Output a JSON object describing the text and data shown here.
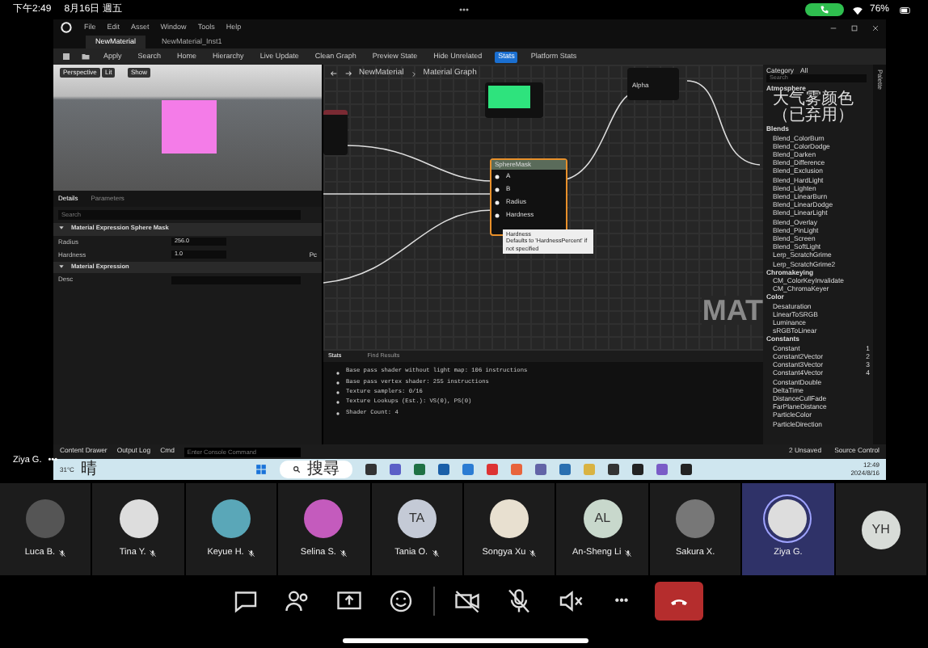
{
  "status_bar": {
    "time": "下午2:49",
    "date": "8月16日 週五",
    "battery": "76%"
  },
  "editor": {
    "menu": [
      "File",
      "Edit",
      "Asset",
      "Window",
      "Tools",
      "Help"
    ],
    "tabs": [
      {
        "label": "NewMaterial",
        "selected": true
      },
      {
        "label": "NewMaterial_Inst1",
        "selected": false
      }
    ],
    "toolbar": [
      {
        "label": "Apply",
        "selected": false
      },
      {
        "label": "Search",
        "selected": false
      },
      {
        "label": "Home",
        "selected": false
      },
      {
        "label": "Hierarchy",
        "selected": false
      },
      {
        "label": "Live Update",
        "selected": false
      },
      {
        "label": "Clean Graph",
        "selected": false
      },
      {
        "label": "Preview State",
        "selected": false
      },
      {
        "label": "Hide Unrelated",
        "selected": false
      },
      {
        "label": "Stats",
        "selected": true
      },
      {
        "label": "Platform Stats",
        "selected": false
      }
    ],
    "viewport": {
      "buttons": [
        "Perspective",
        "Lit",
        "Show"
      ]
    },
    "details": {
      "tabs": [
        {
          "label": "Details",
          "selected": true
        },
        {
          "label": "Parameters",
          "selected": false
        }
      ],
      "search": {
        "placeholder": "Search"
      },
      "sections": [
        {
          "title": "Material Expression Sphere Mask",
          "expanded": true,
          "rows": [
            {
              "label": "Radius",
              "value": "256.0"
            },
            {
              "label": "Hardness",
              "value": "1.0",
              "unit": "Pc"
            }
          ]
        },
        {
          "title": "Material Expression",
          "expanded": true,
          "rows": [
            {
              "label": "Desc"
            }
          ]
        }
      ]
    },
    "graph": {
      "breadcrumb": [
        "NewMaterial",
        "Material Graph"
      ],
      "node": {
        "title": "SphereMask",
        "pins": [
          "A",
          "B",
          "Radius",
          "Hardness"
        ]
      },
      "alpha_pin": "Alpha",
      "tooltip": {
        "title": "Hardness",
        "text": "Defaults to 'HardnessPercent' if not specified"
      },
      "watermark": "MAT"
    },
    "stats": {
      "tabs": [
        {
          "label": "Stats",
          "selected": true
        },
        {
          "label": "Find Results",
          "selected": false
        }
      ],
      "lines": [
        "Base pass shader without light map: 106 instructions",
        "Base pass vertex shader: 255 instructions",
        "Texture samplers: 0/16",
        "Texture Lookups (Est.): VS(0), PS(0)",
        "Shader Count: 4"
      ]
    },
    "palette": {
      "category_label": "Category",
      "category": "All",
      "search": {
        "placeholder": "Search"
      },
      "side_tab": "Palette",
      "groups": [
        {
          "name": "Atmosphere",
          "items": [
            {
              "label": "大气雾颜色（已弃用）"
            }
          ]
        },
        {
          "name": "Blends",
          "items": [
            {
              "label": "Blend_ColorBurn"
            },
            {
              "label": "Blend_ColorDodge"
            },
            {
              "label": "Blend_Darken"
            },
            {
              "label": "Blend_Difference"
            },
            {
              "label": "Blend_Exclusion"
            },
            {
              "label": "Blend_HardLight"
            },
            {
              "label": "Blend_Lighten"
            },
            {
              "label": "Blend_LinearBurn"
            },
            {
              "label": "Blend_LinearDodge"
            },
            {
              "label": "Blend_LinearLight"
            },
            {
              "label": "Blend_Overlay"
            },
            {
              "label": "Blend_PinLight"
            },
            {
              "label": "Blend_Screen"
            },
            {
              "label": "Blend_SoftLight"
            },
            {
              "label": "Lerp_ScratchGrime"
            },
            {
              "label": "Lerp_ScratchGrime2"
            }
          ]
        },
        {
          "name": "Chromakeying",
          "items": [
            {
              "label": "CM_ColorKeyInvalidate"
            },
            {
              "label": "CM_ChromaKeyer"
            }
          ]
        },
        {
          "name": "Color",
          "items": [
            {
              "label": "Desaturation"
            },
            {
              "label": "LinearToSRGB"
            },
            {
              "label": "Luminance"
            },
            {
              "label": "sRGBToLinear"
            }
          ]
        },
        {
          "name": "Constants",
          "items": [
            {
              "label": "Constant",
              "shortcut": "1"
            },
            {
              "label": "Constant2Vector",
              "shortcut": "2"
            },
            {
              "label": "Constant3Vector",
              "shortcut": "3"
            },
            {
              "label": "Constant4Vector",
              "shortcut": "4"
            },
            {
              "label": "ConstantDouble"
            },
            {
              "label": "DeltaTime"
            },
            {
              "label": "DistanceCullFade"
            },
            {
              "label": "FarPlaneDistance"
            },
            {
              "label": "ParticleColor"
            },
            {
              "label": "ParticleDirection"
            }
          ]
        }
      ]
    },
    "bottom_bar": {
      "items": [
        "Content Drawer",
        "Output Log",
        "Cmd"
      ],
      "console": {
        "placeholder": "Enter Console Command"
      },
      "right": [
        "2 Unsaved",
        "Source Control"
      ]
    }
  },
  "taskbar": {
    "weather": "31°C",
    "weather_text": "晴",
    "search": "搜尋",
    "time": "12:49",
    "date": "2024/8/16"
  },
  "presenter": {
    "name": "Ziya G.",
    "menu": "•••"
  },
  "participants": [
    {
      "name": "Luca B.",
      "kind": "photo",
      "muted": true,
      "selected": false
    },
    {
      "name": "Tina Y.",
      "kind": "photo",
      "muted": true,
      "selected": false
    },
    {
      "name": "Keyue H.",
      "kind": "photo",
      "muted": true,
      "selected": false
    },
    {
      "name": "Selina S.",
      "kind": "photo",
      "muted": true,
      "selected": false
    },
    {
      "name": "Tania O.",
      "kind": "initials",
      "initials": "TA",
      "muted": true,
      "selected": false
    },
    {
      "name": "Songya Xu",
      "kind": "photo",
      "muted": true,
      "selected": false
    },
    {
      "name": "An-Sheng Li",
      "kind": "initials",
      "initials": "AL",
      "muted": true,
      "selected": false
    },
    {
      "name": "Sakura X.",
      "kind": "photo",
      "muted": false,
      "selected": false
    },
    {
      "name": "Ziya G.",
      "kind": "photo",
      "muted": false,
      "selected": true
    },
    {
      "kind": "initials",
      "initials": "YH",
      "muted": false,
      "selected": false
    }
  ],
  "controls": [
    {
      "kind": "chat"
    },
    {
      "kind": "people"
    },
    {
      "kind": "share"
    },
    {
      "kind": "react"
    },
    {
      "kind": "camera",
      "on": false
    },
    {
      "kind": "mic",
      "on": false
    },
    {
      "kind": "speaker",
      "on": false
    },
    {
      "kind": "more",
      "label": "•••"
    },
    {
      "kind": "hangup"
    }
  ]
}
